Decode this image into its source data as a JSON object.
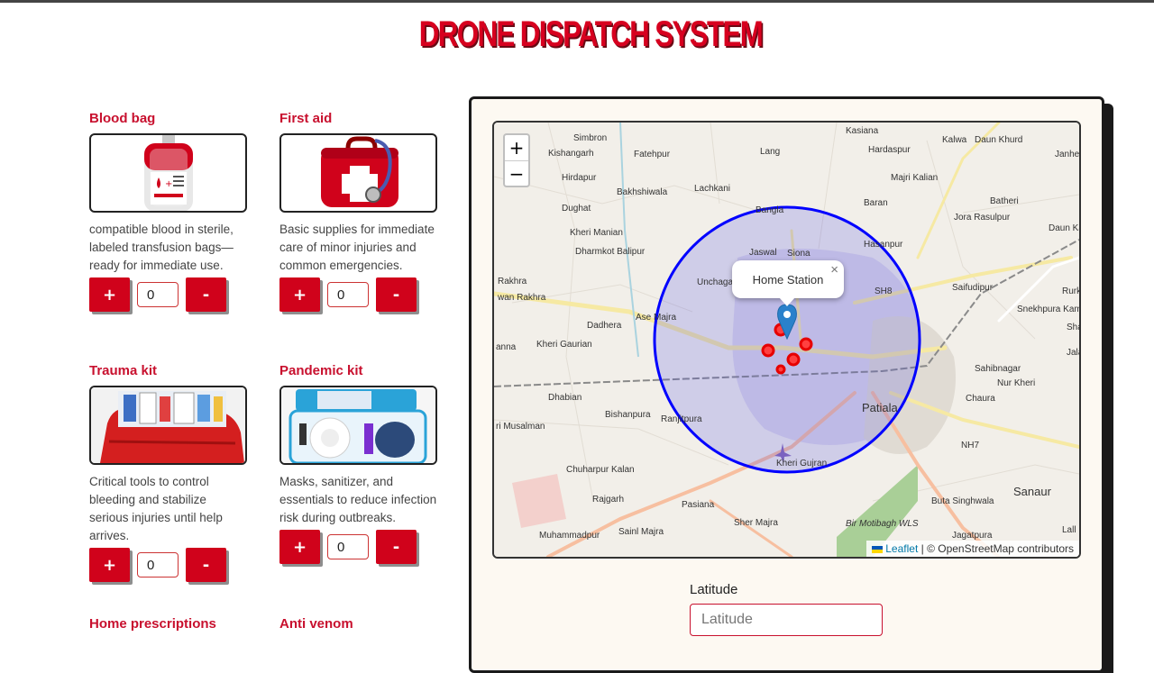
{
  "header": {
    "title": "DRONE DISPATCH SYSTEM"
  },
  "kits": [
    {
      "title": "Blood bag",
      "description": "compatible blood in sterile, labeled transfusion bags—ready for immediate use.",
      "quantity": "0",
      "plus_label": "+",
      "minus_label": "-"
    },
    {
      "title": "First aid",
      "description": "Basic supplies for immediate care of minor injuries and common emergencies.",
      "quantity": "0",
      "plus_label": "+",
      "minus_label": "-"
    },
    {
      "title": "Trauma kit",
      "description": "Critical tools to control bleeding and stabilize serious injuries until help arrives.",
      "quantity": "0",
      "plus_label": "+",
      "minus_label": "-"
    },
    {
      "title": "Pandemic kit",
      "description": "Masks, sanitizer, and essentials to reduce infection risk during outbreaks.",
      "quantity": "0",
      "plus_label": "+",
      "minus_label": "-"
    },
    {
      "title": "Home prescriptions"
    },
    {
      "title": "Anti venom"
    }
  ],
  "map": {
    "zoom_in": "+",
    "zoom_out": "−",
    "popup_text": "Home Station",
    "popup_close": "×",
    "attribution_leaflet": "Leaflet",
    "attribution_rest": "| © OpenStreetMap contributors",
    "place_labels": [
      "Kasiana",
      "Simbron",
      "Kishangarh",
      "Fatehpur",
      "Lang",
      "Hardaspur",
      "Kalwa",
      "Daun Khurd",
      "Janheri",
      "Hirdapur",
      "Bakhshiwala",
      "Lachkani",
      "Majri Kalian",
      "Baran",
      "Batheri",
      "Jora Rasulpur",
      "Dughat",
      "Daun Kala",
      "Kheri Manian",
      "Bangla",
      "Hasanpur",
      "Dharmkot Balipur",
      "Jaswal",
      "Siona",
      "Rakhra",
      "Unchagaon",
      "SH8",
      "Saifudipur",
      "wan Rakhra",
      "Rurk",
      "Snekhpura Kambohan",
      "Ase Majra",
      "Dadhera",
      "Shar",
      "anna",
      "Kheri Gaurian",
      "Jalalp",
      "Sahibnagar",
      "Nur Kheri",
      "Dhabian",
      "Patiala",
      "Chaura",
      "Bishanpura",
      "Ranjitpura",
      "ri Musalman",
      "NH7",
      "Kheri Gujran",
      "Chuharpur Kalan",
      "Buta Singhwala",
      "Sanaur",
      "Rajgarh",
      "Pasiana",
      "Sher Majra",
      "Bir Motibagh WLS",
      "Jagatpura",
      "Muhammadpur",
      "Sainl Majra",
      "Lall"
    ],
    "radius_color": "#0000ff",
    "marker_color": "#2a81cb",
    "point_color": "#e60000"
  },
  "form": {
    "latitude_label": "Latitude",
    "latitude_placeholder": "Latitude"
  }
}
